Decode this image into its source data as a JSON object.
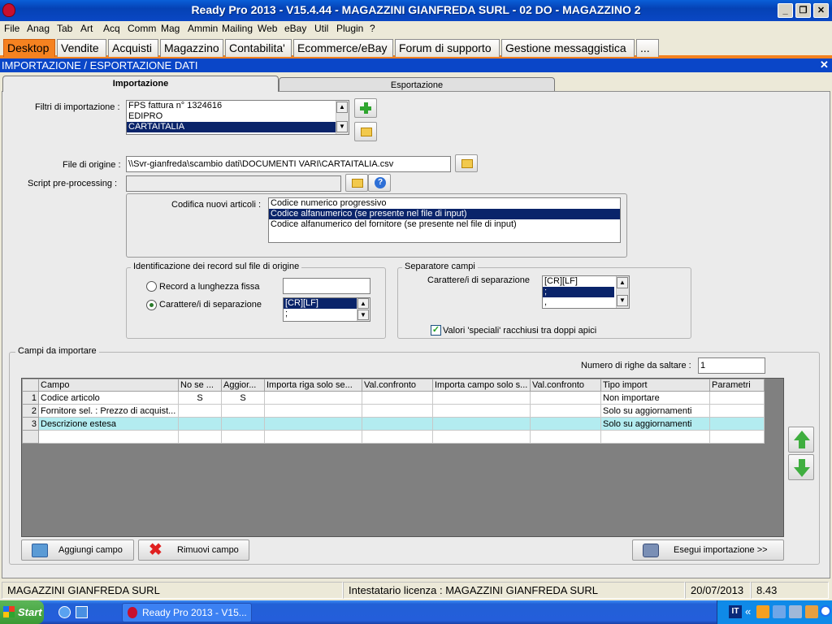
{
  "window": {
    "title": "Ready Pro 2013 - V15.4.44 - MAGAZZINI GIANFREDA SURL - 02 DO - MAGAZZINO 2"
  },
  "menu": [
    "File",
    "Anag",
    "Tab",
    "Art",
    "Acq",
    "Comm",
    "Mag",
    "Ammin",
    "Mailing",
    "Web",
    "eBay",
    "Util",
    "Plugin",
    "?"
  ],
  "tabs": [
    "Desktop",
    "Vendite",
    "Acquisti",
    "Magazzino",
    "Contabilita'",
    "Ecommerce/eBay",
    "Forum di supporto",
    "Gestione messaggistica",
    "..."
  ],
  "section_title": "IMPORTAZIONE / ESPORTAZIONE DATI",
  "panel_tabs": {
    "import": "Importazione",
    "export": "Esportazione"
  },
  "filters": {
    "label": "Filtri di importazione :",
    "items": [
      "FPS fattura n° 1324616",
      "EDIPRO",
      "CARTAITALIA"
    ],
    "selected": "CARTAITALIA"
  },
  "file_origine": {
    "label": "File di origine :",
    "value": "\\\\Svr-gianfreda\\scambio dati\\DOCUMENTI VARI\\CARTAITALIA.csv"
  },
  "script": {
    "label": "Script pre-processing :",
    "value": ""
  },
  "codifica": {
    "label": "Codifica nuovi articoli :",
    "items": [
      "Codice numerico progressivo",
      "Codice alfanumerico (se presente nel file di input)",
      "Codice alfanumerico del fornitore (se presente nel file di input)"
    ],
    "selected": "Codice alfanumerico (se presente nel file di input)"
  },
  "identificazione": {
    "title": "Identificazione dei record sul file di origine",
    "fixed_label": "Record a lunghezza fissa",
    "fixed_value": "",
    "sep_label": "Carattere/i di separazione",
    "sep_items": [
      "[CR][LF]",
      ";"
    ],
    "selected": "Carattere/i di separazione"
  },
  "separatore": {
    "title": "Separatore campi",
    "label": "Carattere/i di separazione",
    "items": [
      "[CR][LF]",
      ";",
      ","
    ],
    "quotes_label": "Valori 'speciali' racchiusi tra doppi apici",
    "quotes_checked": true
  },
  "campi": {
    "title": "Campi da importare",
    "skip_label": "Numero di righe da saltare :",
    "skip_value": "1",
    "columns": [
      "Campo",
      "No se ...",
      "Aggior...",
      "Importa riga solo se...",
      "Val.confronto",
      "Importa campo solo s...",
      "Val.confronto",
      "Tipo import",
      "Parametri"
    ],
    "rows": [
      {
        "n": "1",
        "campo": "Codice articolo",
        "nose": "S",
        "aggior": "S",
        "riga": "",
        "val1": "",
        "campo_s": "",
        "val2": "",
        "tipo": "Non importare",
        "param": ""
      },
      {
        "n": "2",
        "campo": "Fornitore sel. : Prezzo di acquist...",
        "nose": "",
        "aggior": "",
        "riga": "",
        "val1": "",
        "campo_s": "",
        "val2": "",
        "tipo": "Solo su aggiornamenti",
        "param": ""
      },
      {
        "n": "3",
        "campo": "Descrizione estesa",
        "nose": "",
        "aggior": "",
        "riga": "",
        "val1": "",
        "campo_s": "",
        "val2": "",
        "tipo": "Solo su aggiornamenti",
        "param": ""
      }
    ]
  },
  "buttons": {
    "add": "Aggiungi campo",
    "remove": "Rimuovi campo",
    "run": "Esegui importazione >>"
  },
  "status": {
    "company": "MAGAZZINI GIANFREDA SURL",
    "license": "Intestatario licenza : MAGAZZINI GIANFREDA SURL",
    "date": "20/07/2013",
    "time": "8.43"
  },
  "taskbar": {
    "start": "Start",
    "app": "Ready Pro 2013 - V15...",
    "lang": "IT"
  }
}
